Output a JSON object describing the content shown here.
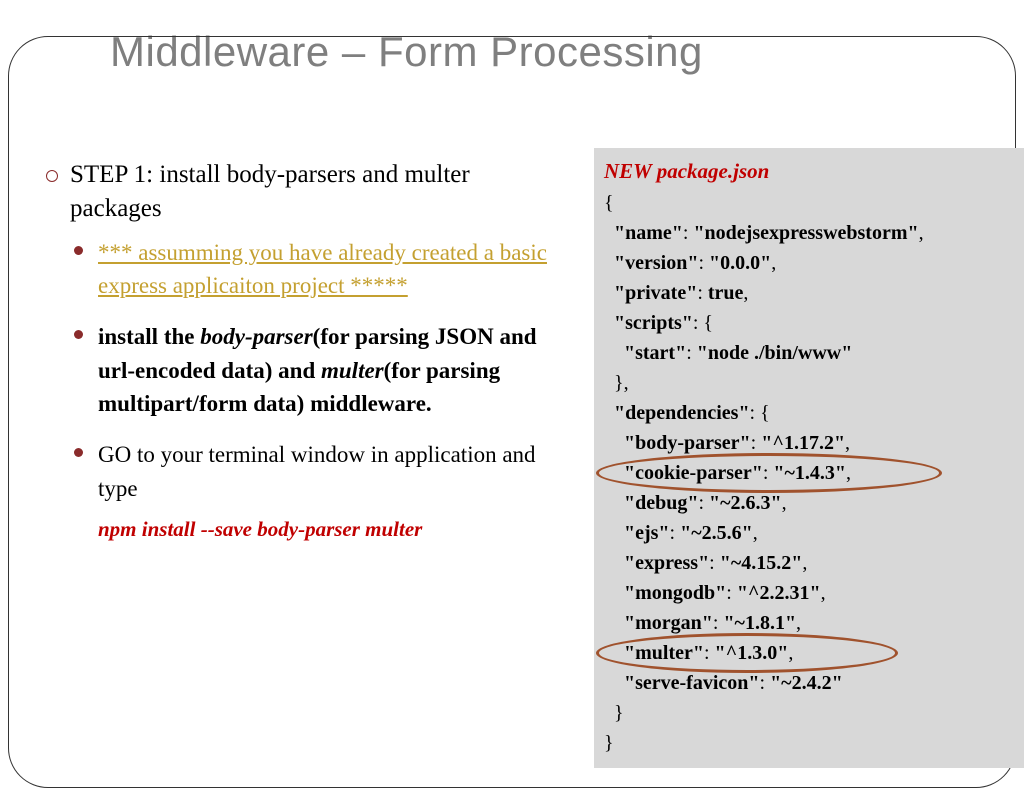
{
  "title": "Middleware – Form Processing",
  "step1": "STEP 1: install body-parsers and multer packages",
  "assume": "*** assumming you have already created a basic express applicaiton project *****",
  "install_a": " install the ",
  "install_b": "body-parser",
  "install_c": "(for parsing JSON and url-encoded data) and ",
  "install_d": "multer",
  "install_e": "(for parsing multipart/form data) middleware.",
  "goto": "GO to your terminal window in application and type",
  "cmd": "npm install --save body-parser multer",
  "code_header": "NEW package.json",
  "code": {
    "l1": "{",
    "l2a": "  \"name\"",
    "l2b": ": ",
    "l2c": "\"nodejsexpresswebstorm\"",
    "l2d": ",",
    "l3a": "  \"version\"",
    "l3b": ": ",
    "l3c": "\"0.0.0\"",
    "l3d": ",",
    "l4a": "  \"private\"",
    "l4b": ": ",
    "l4c": "true",
    "l4d": ",",
    "l5a": "  \"scripts\"",
    "l5b": ": {",
    "l6a": "    \"start\"",
    "l6b": ": ",
    "l6c": "\"node ./bin/www\"",
    "l7": "  },",
    "l8a": "  \"dependencies\"",
    "l8b": ": {",
    "l9a": "    \"body-parser\"",
    "l9b": ": ",
    "l9c": "\"^1.17.2\"",
    "l9d": ",",
    "l10a": "    \"cookie-parser\"",
    "l10b": ": ",
    "l10c": "\"~1.4.3\"",
    "l10d": ",",
    "l11a": "    \"debug\"",
    "l11b": ": ",
    "l11c": "\"~2.6.3\"",
    "l11d": ",",
    "l12a": "    \"ejs\"",
    "l12b": ": ",
    "l12c": "\"~2.5.6\"",
    "l12d": ",",
    "l13a": "    \"express\"",
    "l13b": ": ",
    "l13c": "\"~4.15.2\"",
    "l13d": ",",
    "l14a": "    \"mongodb\"",
    "l14b": ": ",
    "l14c": "\"^2.2.31\"",
    "l14d": ",",
    "l15a": "    \"morgan\"",
    "l15b": ": ",
    "l15c": "\"~1.8.1\"",
    "l15d": ",",
    "l16a": "    \"multer\"",
    "l16b": ": ",
    "l16c": "\"^1.3.0\"",
    "l16d": ",",
    "l17a": "    \"serve-favicon\"",
    "l17b": ": ",
    "l17c": "\"~2.4.2\"",
    "l18": "  }",
    "l19": "}"
  }
}
